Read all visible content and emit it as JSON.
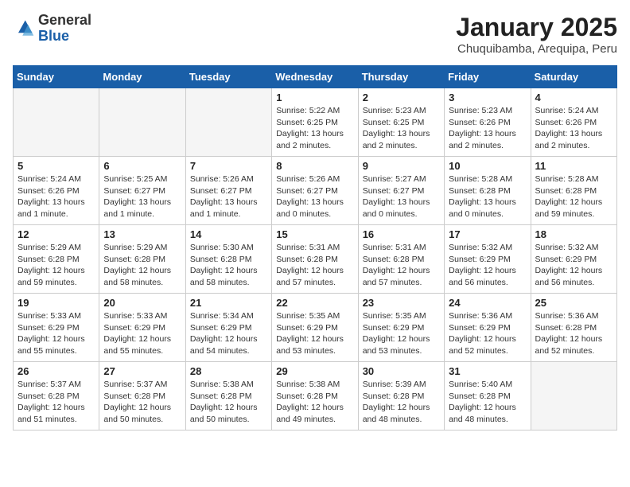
{
  "header": {
    "logo_general": "General",
    "logo_blue": "Blue",
    "month_title": "January 2025",
    "subtitle": "Chuquibamba, Arequipa, Peru"
  },
  "days_of_week": [
    "Sunday",
    "Monday",
    "Tuesday",
    "Wednesday",
    "Thursday",
    "Friday",
    "Saturday"
  ],
  "weeks": [
    [
      {
        "day": "",
        "info": ""
      },
      {
        "day": "",
        "info": ""
      },
      {
        "day": "",
        "info": ""
      },
      {
        "day": "1",
        "info": "Sunrise: 5:22 AM\nSunset: 6:25 PM\nDaylight: 13 hours and 2 minutes."
      },
      {
        "day": "2",
        "info": "Sunrise: 5:23 AM\nSunset: 6:25 PM\nDaylight: 13 hours and 2 minutes."
      },
      {
        "day": "3",
        "info": "Sunrise: 5:23 AM\nSunset: 6:26 PM\nDaylight: 13 hours and 2 minutes."
      },
      {
        "day": "4",
        "info": "Sunrise: 5:24 AM\nSunset: 6:26 PM\nDaylight: 13 hours and 2 minutes."
      }
    ],
    [
      {
        "day": "5",
        "info": "Sunrise: 5:24 AM\nSunset: 6:26 PM\nDaylight: 13 hours and 1 minute."
      },
      {
        "day": "6",
        "info": "Sunrise: 5:25 AM\nSunset: 6:27 PM\nDaylight: 13 hours and 1 minute."
      },
      {
        "day": "7",
        "info": "Sunrise: 5:26 AM\nSunset: 6:27 PM\nDaylight: 13 hours and 1 minute."
      },
      {
        "day": "8",
        "info": "Sunrise: 5:26 AM\nSunset: 6:27 PM\nDaylight: 13 hours and 0 minutes."
      },
      {
        "day": "9",
        "info": "Sunrise: 5:27 AM\nSunset: 6:27 PM\nDaylight: 13 hours and 0 minutes."
      },
      {
        "day": "10",
        "info": "Sunrise: 5:28 AM\nSunset: 6:28 PM\nDaylight: 13 hours and 0 minutes."
      },
      {
        "day": "11",
        "info": "Sunrise: 5:28 AM\nSunset: 6:28 PM\nDaylight: 12 hours and 59 minutes."
      }
    ],
    [
      {
        "day": "12",
        "info": "Sunrise: 5:29 AM\nSunset: 6:28 PM\nDaylight: 12 hours and 59 minutes."
      },
      {
        "day": "13",
        "info": "Sunrise: 5:29 AM\nSunset: 6:28 PM\nDaylight: 12 hours and 58 minutes."
      },
      {
        "day": "14",
        "info": "Sunrise: 5:30 AM\nSunset: 6:28 PM\nDaylight: 12 hours and 58 minutes."
      },
      {
        "day": "15",
        "info": "Sunrise: 5:31 AM\nSunset: 6:28 PM\nDaylight: 12 hours and 57 minutes."
      },
      {
        "day": "16",
        "info": "Sunrise: 5:31 AM\nSunset: 6:28 PM\nDaylight: 12 hours and 57 minutes."
      },
      {
        "day": "17",
        "info": "Sunrise: 5:32 AM\nSunset: 6:29 PM\nDaylight: 12 hours and 56 minutes."
      },
      {
        "day": "18",
        "info": "Sunrise: 5:32 AM\nSunset: 6:29 PM\nDaylight: 12 hours and 56 minutes."
      }
    ],
    [
      {
        "day": "19",
        "info": "Sunrise: 5:33 AM\nSunset: 6:29 PM\nDaylight: 12 hours and 55 minutes."
      },
      {
        "day": "20",
        "info": "Sunrise: 5:33 AM\nSunset: 6:29 PM\nDaylight: 12 hours and 55 minutes."
      },
      {
        "day": "21",
        "info": "Sunrise: 5:34 AM\nSunset: 6:29 PM\nDaylight: 12 hours and 54 minutes."
      },
      {
        "day": "22",
        "info": "Sunrise: 5:35 AM\nSunset: 6:29 PM\nDaylight: 12 hours and 53 minutes."
      },
      {
        "day": "23",
        "info": "Sunrise: 5:35 AM\nSunset: 6:29 PM\nDaylight: 12 hours and 53 minutes."
      },
      {
        "day": "24",
        "info": "Sunrise: 5:36 AM\nSunset: 6:29 PM\nDaylight: 12 hours and 52 minutes."
      },
      {
        "day": "25",
        "info": "Sunrise: 5:36 AM\nSunset: 6:28 PM\nDaylight: 12 hours and 52 minutes."
      }
    ],
    [
      {
        "day": "26",
        "info": "Sunrise: 5:37 AM\nSunset: 6:28 PM\nDaylight: 12 hours and 51 minutes."
      },
      {
        "day": "27",
        "info": "Sunrise: 5:37 AM\nSunset: 6:28 PM\nDaylight: 12 hours and 50 minutes."
      },
      {
        "day": "28",
        "info": "Sunrise: 5:38 AM\nSunset: 6:28 PM\nDaylight: 12 hours and 50 minutes."
      },
      {
        "day": "29",
        "info": "Sunrise: 5:38 AM\nSunset: 6:28 PM\nDaylight: 12 hours and 49 minutes."
      },
      {
        "day": "30",
        "info": "Sunrise: 5:39 AM\nSunset: 6:28 PM\nDaylight: 12 hours and 48 minutes."
      },
      {
        "day": "31",
        "info": "Sunrise: 5:40 AM\nSunset: 6:28 PM\nDaylight: 12 hours and 48 minutes."
      },
      {
        "day": "",
        "info": ""
      }
    ]
  ]
}
